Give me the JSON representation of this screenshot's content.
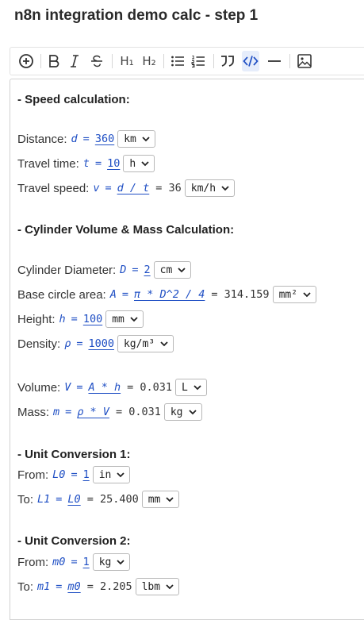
{
  "title": "n8n integration demo calc - step 1",
  "toolbar": {
    "items": [
      "add",
      "bold",
      "italic",
      "strikethrough",
      "heading1",
      "heading2",
      "bullet-list",
      "numbered-list",
      "quote",
      "code",
      "horizontal-rule",
      "image"
    ],
    "h1_label": "H₁",
    "h2_label": "H₂",
    "active": "code",
    "accent_color": "#1f4fc4"
  },
  "sections": {
    "speed": {
      "heading": "- Speed calculation:",
      "distance": {
        "label": "Distance:",
        "var": "d",
        "value": "360",
        "unit": "km"
      },
      "time": {
        "label": "Travel time:",
        "var": "t",
        "value": "10",
        "unit": "h"
      },
      "speed": {
        "label": "Travel speed:",
        "var": "v",
        "expr": "d / t",
        "result": "= 36",
        "unit": "km/h"
      }
    },
    "cylinder": {
      "heading": "- Cylinder Volume & Mass Calculation:",
      "diameter": {
        "label": "Cylinder Diameter:",
        "var": "D",
        "value": "2",
        "unit": "cm"
      },
      "area": {
        "label": "Base circle area:",
        "var": "A",
        "expr": "π * D^2 / 4",
        "result": "= 314.159",
        "unit": "mm²"
      },
      "height": {
        "label": "Height:",
        "var": "h",
        "value": "100",
        "unit": "mm"
      },
      "density": {
        "label": "Density:",
        "var": "ρ",
        "value": "1000",
        "unit": "kg/m³"
      },
      "volume": {
        "label": "Volume:",
        "var": "V",
        "expr": "A * h",
        "result": "= 0.031",
        "unit": "L"
      },
      "mass": {
        "label": "Mass:",
        "var": "m",
        "expr": "ρ * V",
        "result": "= 0.031",
        "unit": "kg"
      }
    },
    "conv1": {
      "heading": "- Unit Conversion 1:",
      "from": {
        "label": "From:",
        "var": "L0",
        "value": "1",
        "unit": "in"
      },
      "to": {
        "label": "To:",
        "var": "L1",
        "expr": "L0",
        "result": "= 25.400",
        "unit": "mm"
      }
    },
    "conv2": {
      "heading": "- Unit Conversion 2:",
      "from": {
        "label": "From:",
        "var": "m0",
        "value": "1",
        "unit": "kg"
      },
      "to": {
        "label": "To:",
        "var": "m1",
        "expr": "m0",
        "result": "= 2.205",
        "unit": "lbm"
      }
    }
  },
  "equals": "="
}
